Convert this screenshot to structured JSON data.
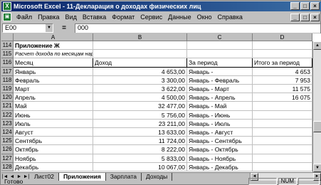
{
  "titlebar": {
    "app_icon": "excel-icon",
    "title": "Microsoft Excel - 11-Декларация о доходах физических лиц",
    "buttons": [
      "_",
      "□",
      "×"
    ]
  },
  "menubar": {
    "doc_icon": "workbook-icon",
    "items": [
      "Файл",
      "Правка",
      "Вид",
      "Вставка",
      "Формат",
      "Сервис",
      "Данные",
      "Окно",
      "Справка"
    ],
    "window_buttons": [
      "_",
      "□",
      "×"
    ]
  },
  "formulabar": {
    "name_box": "E00",
    "equals": "=",
    "value": "000"
  },
  "sheet": {
    "columns": [
      "A",
      "B",
      "C",
      "D"
    ],
    "rows": [
      {
        "num": "114",
        "a": "Приложение Ж",
        "b": "",
        "c": "",
        "d": "",
        "style": "bold"
      },
      {
        "num": "115",
        "a": "Расчет дохода по месяцам нарастающим итогом",
        "b": "",
        "c": "",
        "d": "",
        "style": "ital"
      },
      {
        "num": "116",
        "a": "Месяц",
        "b": "Доход",
        "c": "За период",
        "d": "Итого за период",
        "style": "header"
      },
      {
        "num": "117",
        "a": "Январь",
        "b": "4 653,00",
        "c": "Январь -",
        "d": "4 653"
      },
      {
        "num": "118",
        "a": "Февраль",
        "b": "3 300,00",
        "c": "Январь - Февраль",
        "d": "7 953"
      },
      {
        "num": "119",
        "a": "Март",
        "b": "3 622,00",
        "c": "Январь - Март",
        "d": "11 575"
      },
      {
        "num": "120",
        "a": "Апрель",
        "b": "4 500,00",
        "c": "Январь - Апрель",
        "d": "16 075"
      },
      {
        "num": "121",
        "a": "Май",
        "b": "32 477,00",
        "c": "Январь - Май",
        "d": ""
      },
      {
        "num": "122",
        "a": "Июнь",
        "b": "5 756,00",
        "c": "Январь - Июнь",
        "d": ""
      },
      {
        "num": "123",
        "a": "Июль",
        "b": "23 211,00",
        "c": "Январь - Июль",
        "d": ""
      },
      {
        "num": "124",
        "a": "Август",
        "b": "13 633,00",
        "c": "Январь - Август",
        "d": ""
      },
      {
        "num": "125",
        "a": "Сентябрь",
        "b": "11 724,00",
        "c": "Январь - Сентябрь",
        "d": ""
      },
      {
        "num": "126",
        "a": "Октябрь",
        "b": "8 222,00",
        "c": "Январь - Октябрь",
        "d": ""
      },
      {
        "num": "127",
        "a": "Ноябрь",
        "b": "5 833,00",
        "c": "Январь - Ноябрь",
        "d": ""
      },
      {
        "num": "128",
        "a": "Декабрь",
        "b": "10 067,00",
        "c": "Январь - Декабрь",
        "d": ""
      }
    ]
  },
  "tabs": {
    "nav": [
      "|◄",
      "◄",
      "►",
      "►|"
    ],
    "sheets": [
      "Лист02",
      "Приложения",
      "Зарплата",
      "Доходы"
    ],
    "active": "Приложения"
  },
  "statusbar": {
    "text": "Готово",
    "num": "NUM"
  }
}
